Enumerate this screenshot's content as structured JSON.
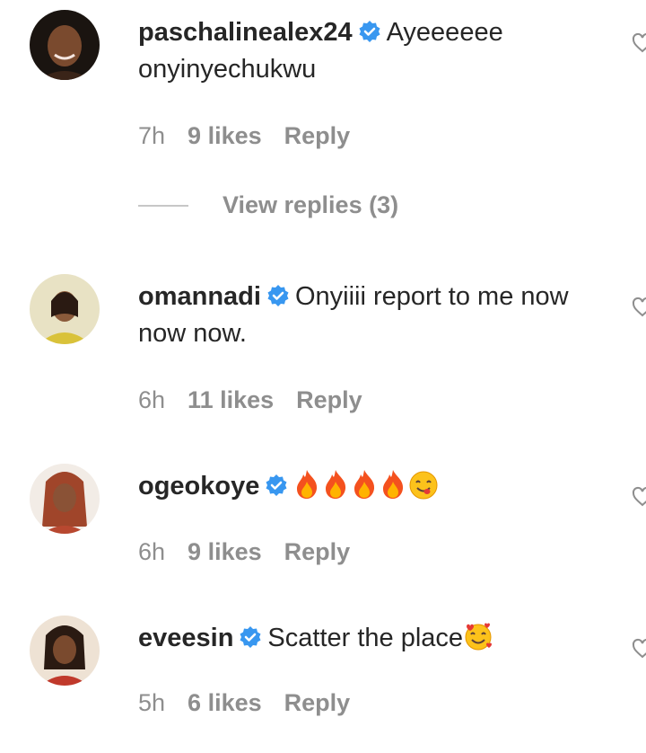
{
  "comments": [
    {
      "username": "paschalinealex24",
      "text": "Ayeeeeee onyinyechukwu",
      "time": "7h",
      "likes": "9 likes",
      "reply": "Reply",
      "verified": true,
      "view_replies": "View replies (3)"
    },
    {
      "username": "omannadi",
      "text": "Onyiiii report to me now now now.",
      "time": "6h",
      "likes": "11 likes",
      "reply": "Reply",
      "verified": true
    },
    {
      "username": "ogeokoye",
      "text": "",
      "emojis": [
        "fire",
        "fire",
        "fire",
        "fire",
        "savoring-food-face"
      ],
      "time": "6h",
      "likes": "9 likes",
      "reply": "Reply",
      "verified": true
    },
    {
      "username": "eveesin",
      "text": "Scatter the place",
      "emojis": [
        "smiling-face-with-hearts"
      ],
      "time": "5h",
      "likes": "6 likes",
      "reply": "Reply",
      "verified": true
    }
  ],
  "colors": {
    "text": "#262626",
    "meta": "#8e8e8e",
    "verified": "#3897f0"
  },
  "icons": {
    "like": "heart-outline-icon",
    "verified": "verified-badge-icon"
  }
}
